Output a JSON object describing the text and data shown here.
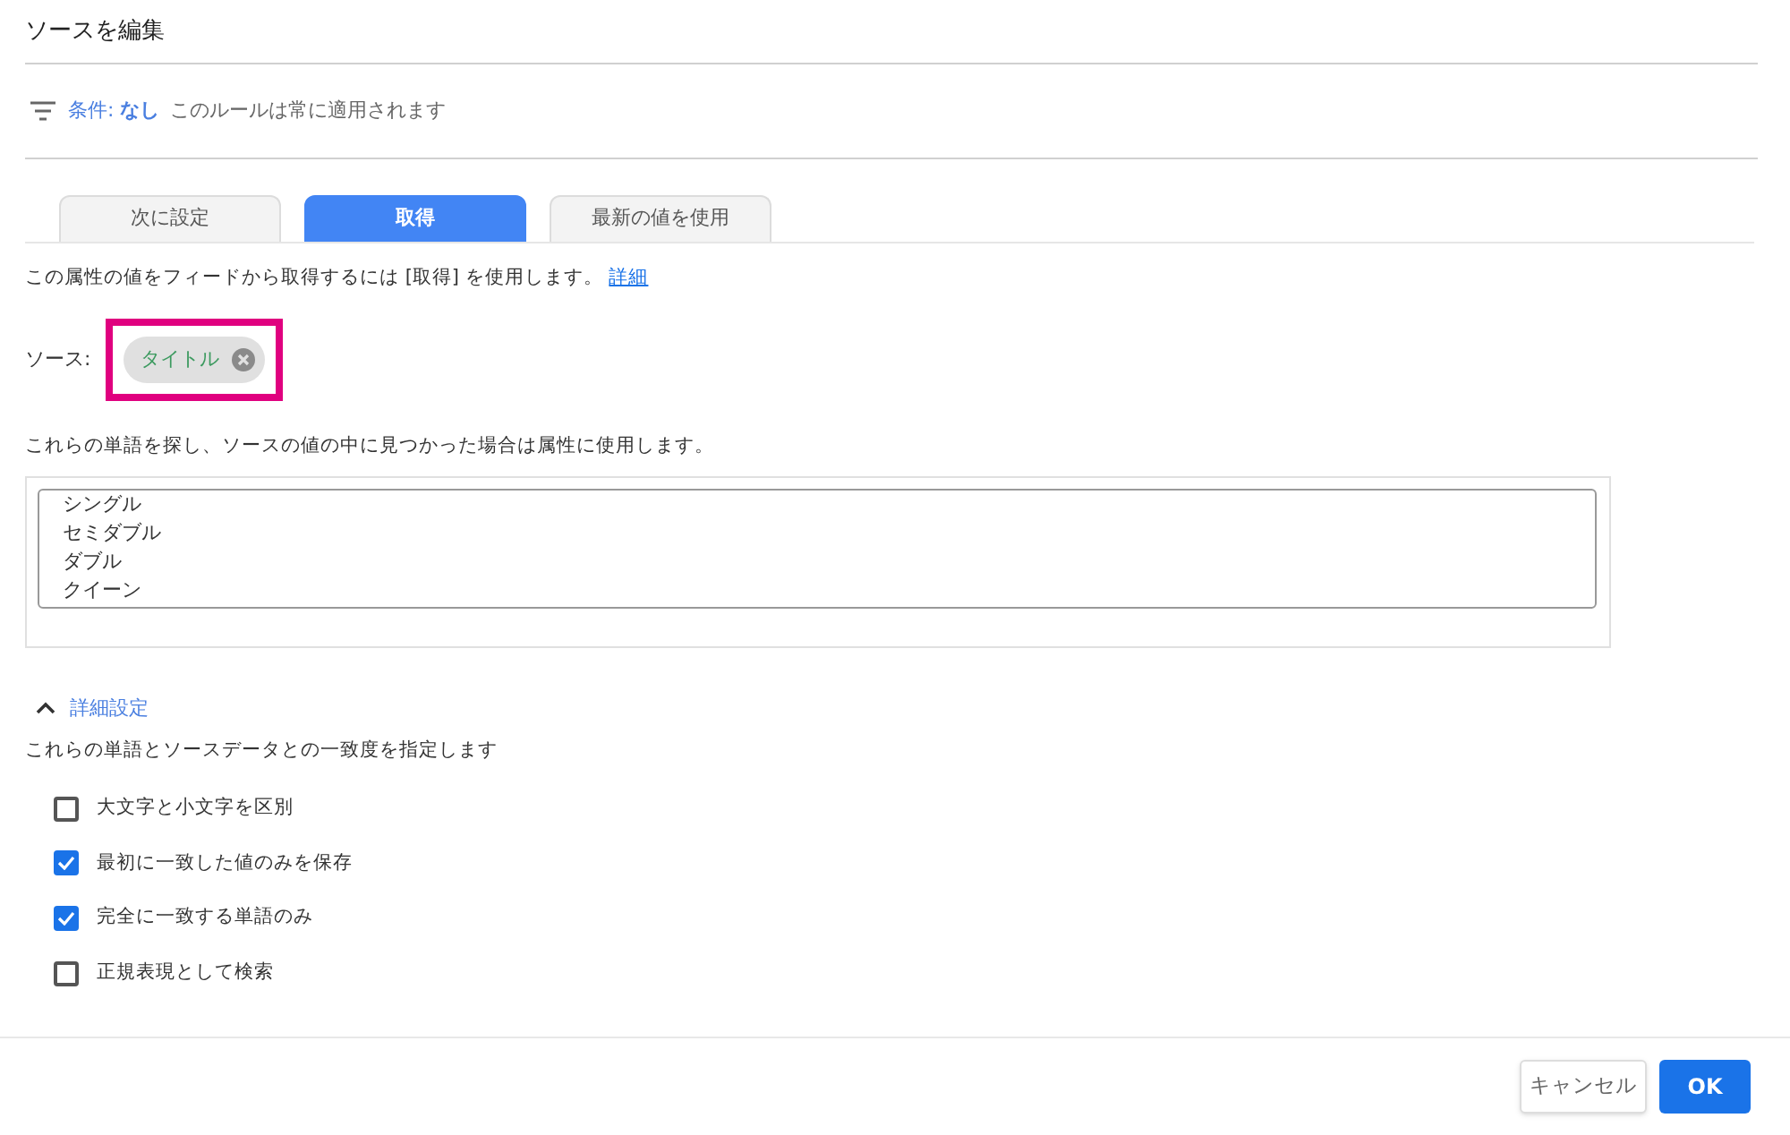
{
  "dialog": {
    "title": "ソースを編集"
  },
  "condition": {
    "label": "条件:",
    "value": "なし",
    "note": "このルールは常に適用されます"
  },
  "tabs": [
    {
      "label": "次に設定",
      "selected": false
    },
    {
      "label": "取得",
      "selected": true
    },
    {
      "label": "最新の値を使用",
      "selected": false
    }
  ],
  "description": {
    "text": "この属性の値をフィードから取得するには [取得] を使用します。",
    "link": "詳細"
  },
  "source": {
    "label": "ソース:",
    "chip": "タイトル",
    "highlighted": true
  },
  "words_instruction": "これらの単語を探し、ソースの値の中に見つかった場合は属性に使用します。",
  "words": [
    "シングル",
    "セミダブル",
    "ダブル",
    "クイーン"
  ],
  "advanced": {
    "label": "詳細設定",
    "expanded": true,
    "description": "これらの単語とソースデータとの一致度を指定します",
    "options": [
      {
        "label": "大文字と小文字を区別",
        "checked": false
      },
      {
        "label": "最初に一致した値のみを保存",
        "checked": true
      },
      {
        "label": "完全に一致する単語のみ",
        "checked": true
      },
      {
        "label": "正規表現として検索",
        "checked": false
      }
    ]
  },
  "buttons": {
    "cancel": "キャンセル",
    "ok": "OK"
  }
}
